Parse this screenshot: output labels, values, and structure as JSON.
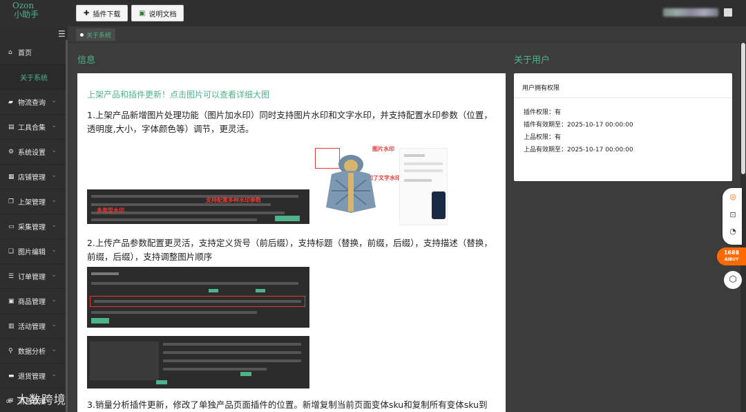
{
  "app": {
    "logo_line1": "Ozon",
    "logo_line2": "小助手"
  },
  "toolbar": {
    "plugin_download": "插件下载",
    "docs": "说明文档"
  },
  "sidebar": {
    "items": [
      {
        "label": "首页",
        "icon": "home-icon"
      },
      {
        "label": "关于系统",
        "sub": true
      },
      {
        "label": "物流查询",
        "icon": "truck-icon"
      },
      {
        "label": "工具合集",
        "icon": "toolbox-icon"
      },
      {
        "label": "系统设置",
        "icon": "gear-icon"
      },
      {
        "label": "店铺管理",
        "icon": "store-icon"
      },
      {
        "label": "上架管理",
        "icon": "copy-icon"
      },
      {
        "label": "采集管理",
        "icon": "car-icon"
      },
      {
        "label": "图片编辑",
        "icon": "image-icon"
      },
      {
        "label": "订单管理",
        "icon": "list-icon"
      },
      {
        "label": "商品管理",
        "icon": "box-icon"
      },
      {
        "label": "活动管理",
        "icon": "calendar-icon"
      },
      {
        "label": "数据分析",
        "icon": "search-icon"
      },
      {
        "label": "退货管理",
        "icon": "return-icon"
      },
      {
        "label": "消息管理",
        "icon": "message-icon"
      }
    ]
  },
  "tabs": [
    {
      "label": "关于系统",
      "active": true
    }
  ],
  "info": {
    "title": "信息",
    "heading": "上架产品和插件更新！点击图片可以查看详细大图",
    "p1": "1.上架产品新增图片处理功能（图片加水印）同时支持图片水印和文字水印，并支持配置水印参数（位置，透明度,大小，字体颜色等）调节，更灵活。",
    "img1_label_wm": "图片水印",
    "img1_label_textwm": "图片添加了文字水印",
    "img1_label_config": "支持配置多种水印参数",
    "img1_label_multi": "多类型水印",
    "p2": "2.上传产品参数配置更灵活，支持定义货号（前后缀），支持标题（替换，前缀，后缀），支持描述（替换，前缀，后缀），支持调整图片顺序",
    "p3": "3.销量分析插件更新，修改了单独产品页面插件的位置。新增复制当前页面变体sku和复制所有变体sku到"
  },
  "user": {
    "title": "关于用户",
    "card_header": "用户拥有权限",
    "rows": [
      "插件权限：有",
      "插件有效期至：2025-10-17 00:00:00",
      "上品权限：有",
      "上品有效期至：2025-10-17 00:00:00"
    ]
  },
  "widgets": {
    "badge_1688_line1": "1688",
    "badge_1688_line2": "AIBUY"
  },
  "watermark": "大数跨境",
  "colors": {
    "accent": "#4fb38a",
    "sidebar_bg": "#2e2e2e",
    "alert": "#e53935"
  }
}
